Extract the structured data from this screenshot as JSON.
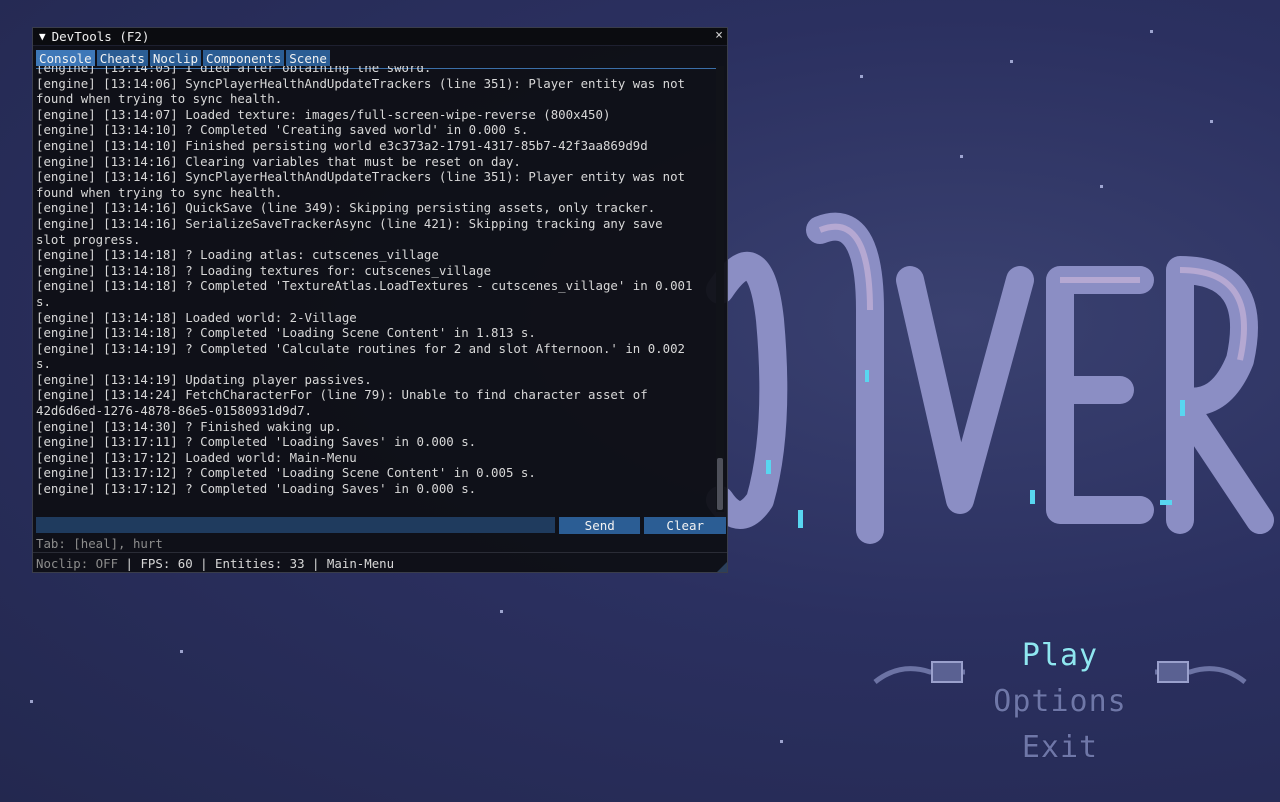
{
  "window": {
    "title": "DevTools (F2)",
    "collapse_glyph": "▼",
    "close_glyph": "×"
  },
  "tabs": [
    {
      "label": "Console",
      "active": true
    },
    {
      "label": "Cheats",
      "active": false
    },
    {
      "label": "Noclip",
      "active": false
    },
    {
      "label": "Components",
      "active": false
    },
    {
      "label": "Scene",
      "active": false
    }
  ],
  "console_lines": [
    "[engine] [13:14:05] I died after obtaining the sword.",
    "[engine] [13:14:06] SyncPlayerHealthAndUpdateTrackers (line 351): Player entity was not",
    "found when trying to sync health.",
    "[engine] [13:14:07] Loaded texture: images/full-screen-wipe-reverse (800x450)",
    "[engine] [13:14:10] ? Completed 'Creating saved world' in 0.000 s.",
    "[engine] [13:14:10] Finished persisting world e3c373a2-1791-4317-85b7-42f3aa869d9d",
    "[engine] [13:14:16] Clearing variables that must be reset on day.",
    "[engine] [13:14:16] SyncPlayerHealthAndUpdateTrackers (line 351): Player entity was not",
    "found when trying to sync health.",
    "[engine] [13:14:16] QuickSave (line 349): Skipping persisting assets, only tracker.",
    "[engine] [13:14:16] SerializeSaveTrackerAsync (line 421): Skipping tracking any save",
    "slot progress.",
    "[engine] [13:14:18] ? Loading atlas: cutscenes_village",
    "[engine] [13:14:18] ? Loading textures for: cutscenes_village",
    "[engine] [13:14:18] ? Completed 'TextureAtlas.LoadTextures - cutscenes_village' in 0.001",
    "s.",
    "[engine] [13:14:18] Loaded world: 2-Village",
    "[engine] [13:14:18] ? Completed 'Loading Scene Content' in 1.813 s.",
    "[engine] [13:14:19] ? Completed 'Calculate routines for 2 and slot Afternoon.' in 0.002",
    "s.",
    "[engine] [13:14:19] Updating player passives.",
    "[engine] [13:14:24] FetchCharacterFor (line 79): Unable to find character asset of",
    "42d6d6ed-1276-4878-86e5-01580931d9d7.",
    "[engine] [13:14:30] ? Finished waking up.",
    "[engine] [13:17:11] ? Completed 'Loading Saves' in 0.000 s.",
    "[engine] [13:17:12] Loaded world: Main-Menu",
    "[engine] [13:17:12] ? Completed 'Loading Scene Content' in 0.005 s.",
    "[engine] [13:17:12] ? Completed 'Loading Saves' in 0.000 s."
  ],
  "input": {
    "value": "",
    "send_label": "Send",
    "clear_label": "Clear"
  },
  "hint": "Tab: [heal], hurt",
  "status": {
    "noclip": "Noclip: OFF",
    "rest": " | FPS: 60 | Entities: 33 | Main-Menu"
  },
  "game_menu": {
    "items": [
      "Play",
      "Options",
      "Exit"
    ],
    "selected": "Play"
  },
  "colors": {
    "tab": "#2b5d94",
    "menu_active": "#8fe6f0",
    "menu_inactive": "#6f77a8",
    "background": "#2b3060"
  }
}
